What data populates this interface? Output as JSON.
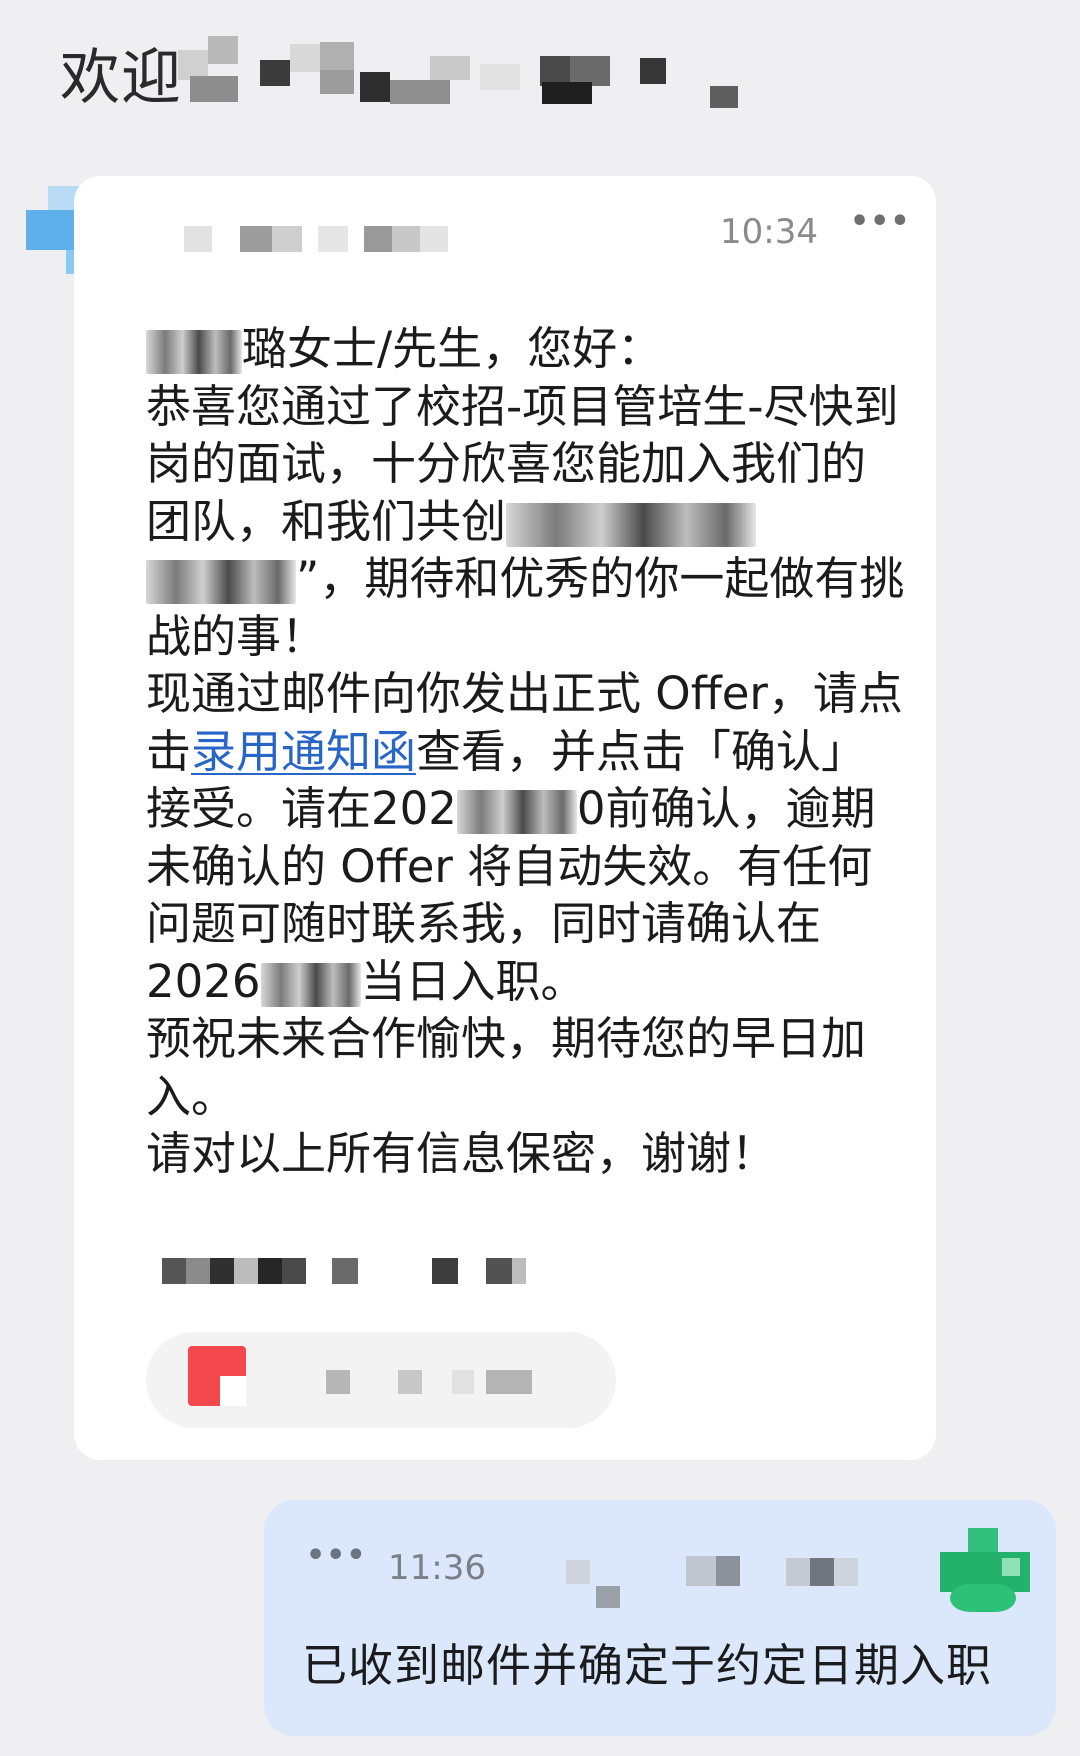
{
  "header": {
    "title": "欢迎"
  },
  "incoming": {
    "time": "10:34",
    "more_icon": "more-horizontal-icon",
    "body": {
      "greeting": "璐女士/先生，您好：",
      "line_congrats": "恭喜您通过了校招-项目管培生-尽快到岗的面试，十分欣喜您能加入我们的团队，和我们共创",
      "line_after_mask": "”，期待和优秀的你一起做有挑战的事！",
      "offer_before_link": "现通过邮件向你发出正式 Offer，请点击",
      "link_text": "录用通知函",
      "offer_after_link": "查看，并点击「确认」接受。请在202",
      "confirm_tail": "0前确认，逾期未确认的 Offer 将自动失效。有任何问题可随时联系我，同时请确认在2026",
      "onboard_tail": "当日入职。",
      "wish": "预祝未来合作愉快，期待您的早日加入。",
      "confidential": "请对以上所有信息保密，谢谢！"
    },
    "attachment_icon": "document-icon",
    "accent_link_color": "#2766c6"
  },
  "outgoing": {
    "time": "11:36",
    "more_icon": "more-horizontal-icon",
    "text": "已收到邮件并确定于约定日期入职",
    "bubble_color": "#dbe8fb"
  }
}
